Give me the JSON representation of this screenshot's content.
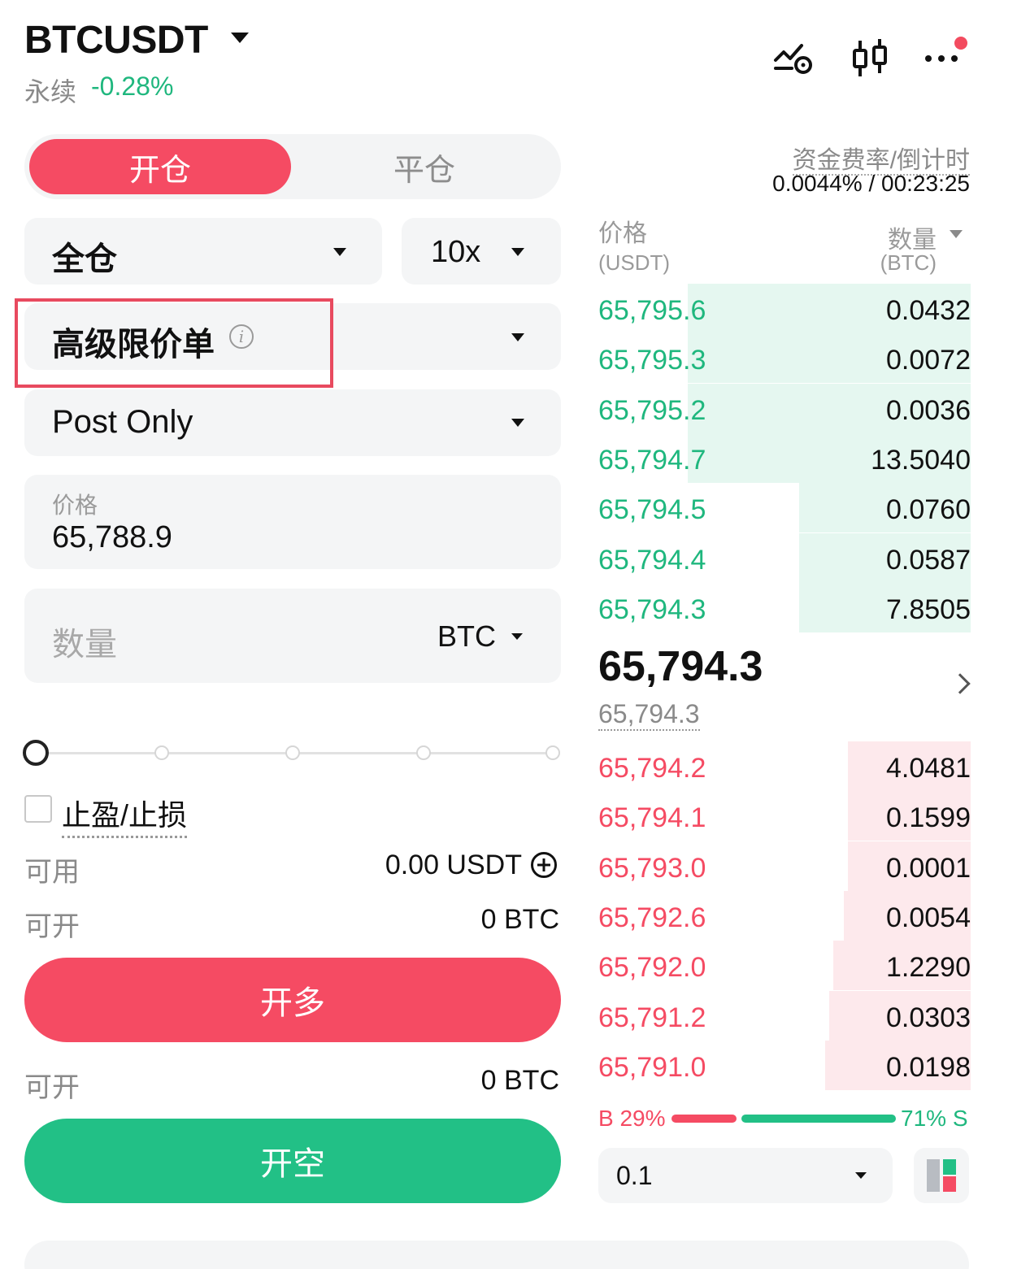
{
  "header": {
    "symbol": "BTCUSDT",
    "contract_type": "永续",
    "change_pct": "-0.28%",
    "icons": [
      "price-alert-icon",
      "candlestick-chart-icon",
      "more-icon"
    ],
    "colors": {
      "up": "#1fb77e",
      "down": "#f54b63"
    }
  },
  "trade": {
    "tab_open": "开仓",
    "tab_close": "平仓",
    "margin_mode": "全仓",
    "leverage": "10x",
    "order_type": "高级限价单",
    "time_in_force": "Post Only",
    "price_caption": "价格",
    "price_value": "65,788.9",
    "qty_placeholder": "数量",
    "qty_unit": "BTC",
    "slider_percent": 0,
    "tpsl_label": "止盈/止损",
    "tpsl_checked": false,
    "available_label": "可用",
    "available_value": "0.00 USDT",
    "can_open_label": "可开",
    "can_open_long": "0 BTC",
    "long_button": "开多",
    "can_open_short": "0 BTC",
    "short_button": "开空"
  },
  "funding": {
    "caption": "资金费率/倒计时",
    "value": "0.0044% / 00:23:25"
  },
  "orderbook": {
    "price_header": "价格",
    "price_unit": "(USDT)",
    "qty_header": "数量",
    "qty_unit": "(BTC)",
    "asks": [
      {
        "price": "65,795.6",
        "qty": "0.0432",
        "depth": 0.76
      },
      {
        "price": "65,795.3",
        "qty": "0.0072",
        "depth": 0.76
      },
      {
        "price": "65,795.2",
        "qty": "0.0036",
        "depth": 0.76
      },
      {
        "price": "65,794.7",
        "qty": "13.5040",
        "depth": 0.76
      },
      {
        "price": "65,794.5",
        "qty": "0.0760",
        "depth": 0.46
      },
      {
        "price": "65,794.4",
        "qty": "0.0587",
        "depth": 0.46
      },
      {
        "price": "65,794.3",
        "qty": "7.8505",
        "depth": 0.46
      }
    ],
    "last_price": "65,794.3",
    "mark_price": "65,794.3",
    "bids": [
      {
        "price": "65,794.2",
        "qty": "4.0481",
        "depth": 0.33
      },
      {
        "price": "65,794.1",
        "qty": "0.1599",
        "depth": 0.33
      },
      {
        "price": "65,793.0",
        "qty": "0.0001",
        "depth": 0.33
      },
      {
        "price": "65,792.6",
        "qty": "0.0054",
        "depth": 0.34
      },
      {
        "price": "65,792.0",
        "qty": "1.2290",
        "depth": 0.37
      },
      {
        "price": "65,791.2",
        "qty": "0.0303",
        "depth": 0.38
      },
      {
        "price": "65,791.0",
        "qty": "0.0198",
        "depth": 0.39
      }
    ],
    "buy_ratio_label": "B 29%",
    "sell_ratio_label": "71% S",
    "buy_ratio": 0.29,
    "precision": "0.1"
  }
}
